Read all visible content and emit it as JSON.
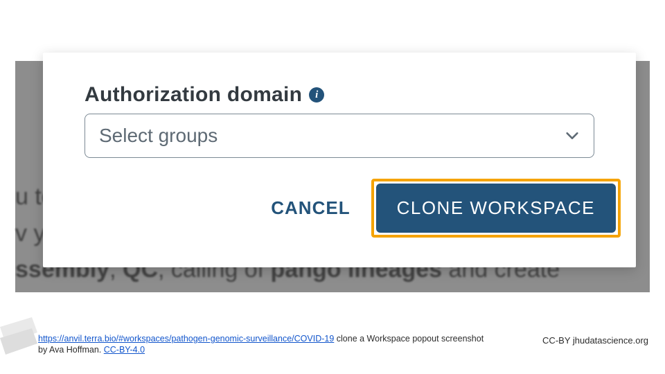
{
  "modal": {
    "section_title": "Authorization domain",
    "info_icon": "i",
    "select_placeholder": "Select groups",
    "cancel_label": "CANCEL",
    "clone_label": "CLONE WORKSPACE"
  },
  "background": {
    "line1_prefix": "u to",
    "line2_prefix": "v y",
    "line3_a": "ssembly",
    "line3_sep1": ", ",
    "line3_b": "QC",
    "line3_mid": ", calling of ",
    "line3_c": "pango lineages",
    "line3_end": " and create"
  },
  "footer": {
    "url_text": "https://anvil.terra.bio/#workspaces/pathogen-genomic-surveillance/COVID-19",
    "caption_after": "  clone a Workspace popout screenshot",
    "by_prefix": "by Ava Hoffman.  ",
    "license_text": "CC-BY-4.0",
    "right": "CC-BY  jhudatascience.org"
  }
}
